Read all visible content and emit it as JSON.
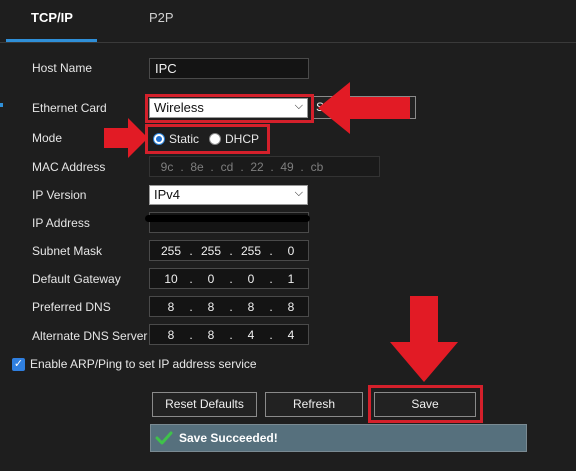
{
  "tabs": [
    {
      "label": "TCP/IP",
      "active": true
    },
    {
      "label": "P2P",
      "active": false
    }
  ],
  "form": {
    "host_name": {
      "label": "Host Name",
      "value": "IPC"
    },
    "ethernet_card": {
      "label": "Ethernet Card",
      "value": "Wireless",
      "side_button_label": "S"
    },
    "mode": {
      "label": "Mode",
      "options": [
        "Static",
        "DHCP"
      ],
      "selected": "Static"
    },
    "mac_address": {
      "label": "MAC Address",
      "octets": [
        "9c",
        "8e",
        "cd",
        "22",
        "49",
        "cb"
      ]
    },
    "ip_version": {
      "label": "IP Version",
      "value": "IPv4"
    },
    "ip_address": {
      "label": "IP Address"
    },
    "subnet_mask": {
      "label": "Subnet Mask",
      "octets": [
        "255",
        "255",
        "255",
        "0"
      ]
    },
    "default_gateway": {
      "label": "Default Gateway",
      "octets": [
        "10",
        "0",
        "0",
        "1"
      ]
    },
    "preferred_dns": {
      "label": "Preferred DNS",
      "octets": [
        "8",
        "8",
        "8",
        "8"
      ]
    },
    "alternate_dns": {
      "label": "Alternate DNS Server",
      "octets": [
        "8",
        "8",
        "4",
        "4"
      ]
    },
    "arp_ping": {
      "label": "Enable ARP/Ping to set IP address service",
      "checked": true
    }
  },
  "buttons": {
    "reset": "Reset Defaults",
    "refresh": "Refresh",
    "save": "Save"
  },
  "status": {
    "message": "Save Succeeded!",
    "icon": "checkmark-icon"
  },
  "colors": {
    "accent": "#2f8fd8",
    "annotation_red": "#d4202b",
    "status_bg": "#56707d",
    "success_green": "#3fc24a"
  }
}
